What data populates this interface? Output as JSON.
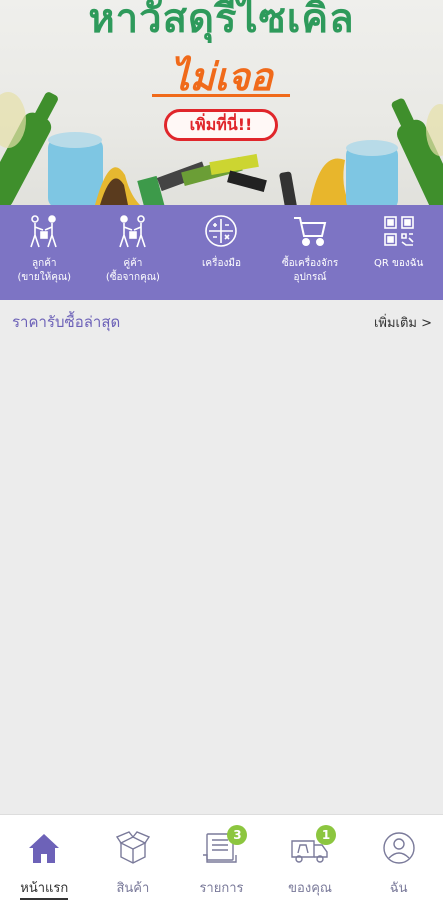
{
  "banner": {
    "headline": "หาวัสดุรีไซเคิล",
    "subheadline": "ไม่เจอ",
    "cta": "เพิ่มที่นี่!!"
  },
  "menu": [
    {
      "label": "ลูกค้า\n(ขายให้คุณ)",
      "icon": "customer-handshake-icon"
    },
    {
      "label": "คู่ค้า\n(ซื้อจากคุณ)",
      "icon": "partner-handshake-icon"
    },
    {
      "label": "เครื่องมือ",
      "icon": "calculator-icon"
    },
    {
      "label": "ซื้อเครื่องจักร\nอุปกรณ์",
      "icon": "shopping-cart-icon"
    },
    {
      "label": "QR ของฉัน",
      "icon": "qr-code-icon"
    }
  ],
  "section": {
    "title": "ราคารับซื้อล่าสุด",
    "more": "เพิ่มเติม >"
  },
  "nav": [
    {
      "label": "หน้าแรก",
      "icon": "home-icon",
      "active": true
    },
    {
      "label": "สินค้า",
      "icon": "box-icon"
    },
    {
      "label": "รายการ",
      "icon": "receipt-icon",
      "badge": "3"
    },
    {
      "label": "ของคุณ",
      "icon": "truck-icon",
      "badge": "1"
    },
    {
      "label": "ฉัน",
      "icon": "profile-icon"
    }
  ],
  "colors": {
    "menu_bg": "#7d74c4",
    "accent": "#6d62b8",
    "badge": "#8cc63f",
    "headline_green": "#2e9a5b",
    "subheadline_orange": "#f06a1a",
    "cta_red": "#e0262b"
  }
}
